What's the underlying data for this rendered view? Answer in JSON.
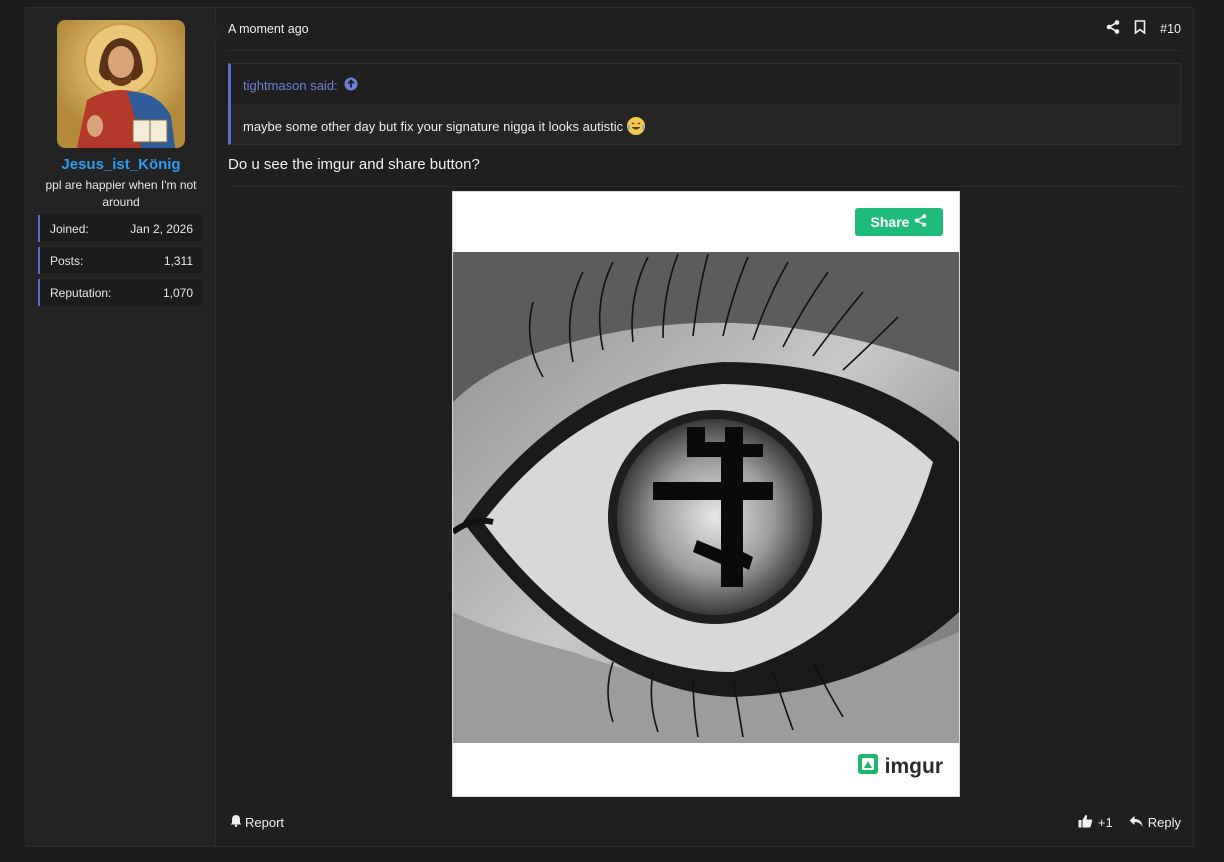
{
  "user": {
    "name": "Jesus_ist_König",
    "title": "ppl are happier when I'm not around",
    "stats": [
      {
        "label": "Joined:",
        "value": "Jan 2, 2026"
      },
      {
        "label": "Posts:",
        "value": "1,311"
      },
      {
        "label": "Reputation:",
        "value": "1,070"
      }
    ]
  },
  "post": {
    "time": "A moment ago",
    "number": "#10",
    "quote": {
      "author": "tightmason said:",
      "text": "maybe some other day but fix your signature nigga it looks autistic"
    },
    "message": "Do u see the imgur and share button?",
    "embed": {
      "share_label": "Share",
      "logo_text": "imgur"
    },
    "footer": {
      "report_label": "Report",
      "like_count": "+1",
      "reply_label": "Reply"
    }
  },
  "colors": {
    "username": "#2f9bf0",
    "accent": "#5b6cd6",
    "share_button": "#1fbb7a"
  },
  "icons": [
    "share-icon",
    "bookmark-icon",
    "arrow-up-circle-icon",
    "share-small-icon",
    "imgur-icon",
    "bell-icon",
    "thumbs-up-icon",
    "reply-icon",
    "grinning-tears-emoji"
  ]
}
